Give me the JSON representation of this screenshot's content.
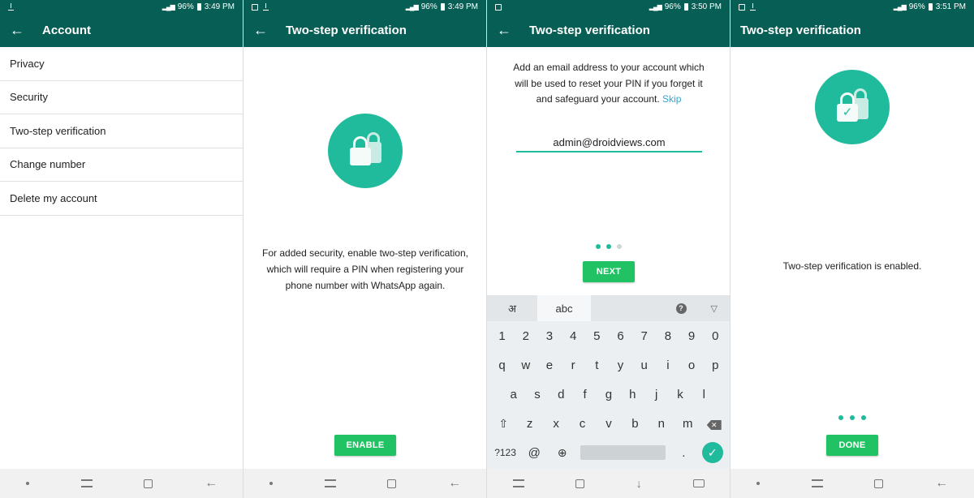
{
  "status": {
    "battery": "96%",
    "times": [
      "3:49 PM",
      "3:49 PM",
      "3:50 PM",
      "3:51 PM"
    ]
  },
  "screen1": {
    "title": "Account",
    "menu": [
      "Privacy",
      "Security",
      "Two-step verification",
      "Change number",
      "Delete my account"
    ]
  },
  "screen2": {
    "title": "Two-step verification",
    "body_lines": [
      "For added security, enable two-step verification,",
      "which will require a PIN when registering your",
      "phone number with WhatsApp again."
    ],
    "button": "ENABLE"
  },
  "screen3": {
    "title": "Two-step verification",
    "body_lines": [
      "Add an email address to your account which",
      "will be used to reset your PIN if you forget it",
      "and safeguard your account."
    ],
    "skip": "Skip",
    "email_value": "admin@droidviews.com",
    "button": "NEXT",
    "keyboard": {
      "lang_tab": "अ",
      "abc_tab": "abc",
      "help": "?",
      "collapse": "▽",
      "row_numbers": [
        "1",
        "2",
        "3",
        "4",
        "5",
        "6",
        "7",
        "8",
        "9",
        "0"
      ],
      "row_q": [
        "q",
        "w",
        "e",
        "r",
        "t",
        "y",
        "u",
        "i",
        "o",
        "p"
      ],
      "row_a": [
        "a",
        "s",
        "d",
        "f",
        "g",
        "h",
        "j",
        "k",
        "l"
      ],
      "row_z": [
        "z",
        "x",
        "c",
        "v",
        "b",
        "n",
        "m"
      ],
      "symbols": "?123",
      "at": "@",
      "period": "."
    }
  },
  "screen4": {
    "title": "Two-step verification",
    "message": "Two-step verification is enabled.",
    "button": "DONE"
  },
  "colors": {
    "toolbar": "#075e54",
    "accent": "#1fbb9c",
    "button": "#21c263",
    "link": "#2fa7d5"
  }
}
